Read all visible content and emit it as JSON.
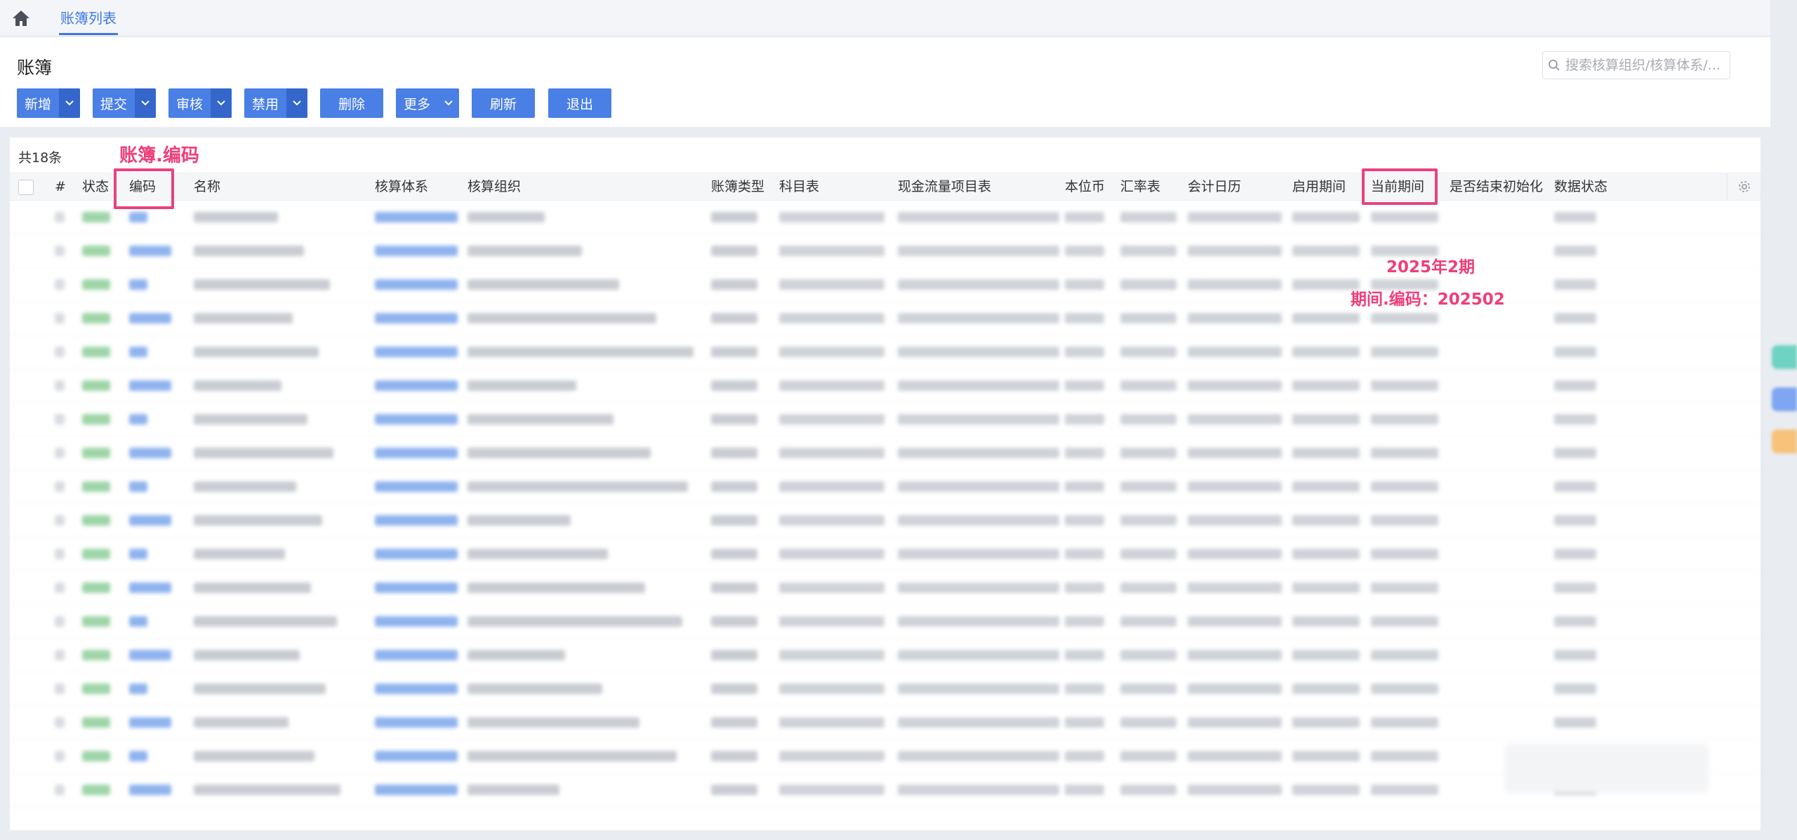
{
  "nav": {
    "home_icon": "home-icon",
    "active_tab": "账簿列表"
  },
  "page": {
    "title": "账簿"
  },
  "search": {
    "placeholder": "搜索核算组织/核算体系/..."
  },
  "toolbar": {
    "add": "新增",
    "submit": "提交",
    "audit": "审核",
    "disable": "禁用",
    "delete": "删除",
    "more": "更多",
    "refresh": "刷新",
    "exit": "退出"
  },
  "table": {
    "count": "共18条",
    "columns": {
      "index": "#",
      "status": "状态",
      "code": "编码",
      "name": "名称",
      "system": "核算体系",
      "org": "核算组织",
      "book_type": "账簿类型",
      "account_chart": "科目表",
      "cashflow": "现金流量项目表",
      "currency": "本位币",
      "rate_table": "汇率表",
      "calendar": "会计日历",
      "start_period": "启用期间",
      "current_period": "当前期间",
      "init_done": "是否结束初始化",
      "data_status": "数据状态"
    },
    "row_count": 18
  },
  "annotations": {
    "code_label": "账簿.编码",
    "period_line1": "2025年2期",
    "period_line2": "期间.编码：202502",
    "color": "#e8437d"
  },
  "colors": {
    "accent": "#4a7fe5",
    "accent_dark": "#3466cc",
    "annotation": "#ee3f7a",
    "status_green": "#9ed5a8",
    "link_blue": "#8fb3ee"
  }
}
